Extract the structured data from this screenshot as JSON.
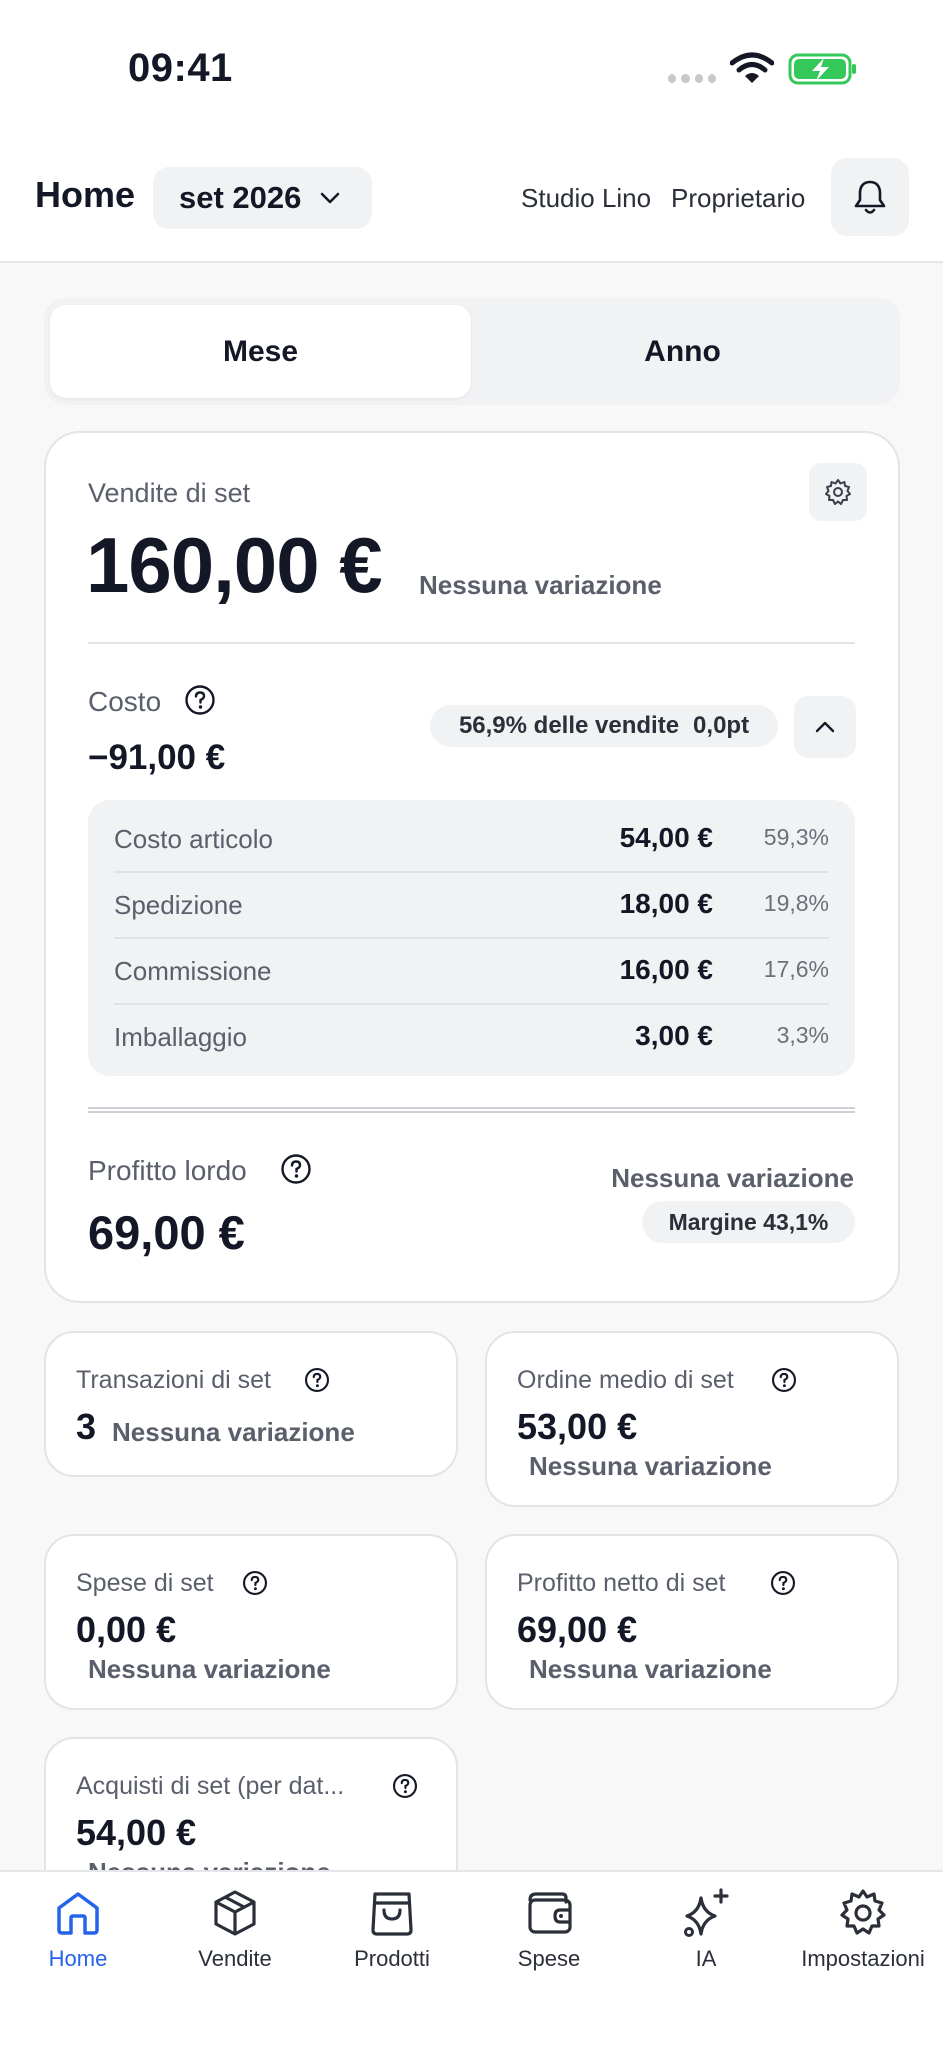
{
  "status_bar": {
    "time": "09:41"
  },
  "header": {
    "title": "Home",
    "month": "set 2026",
    "shop_name": "Studio Lino",
    "role": "Proprietario"
  },
  "segmented": {
    "month_label": "Mese",
    "year_label": "Anno",
    "active": "Mese"
  },
  "sales": {
    "label": "Vendite di set",
    "value": "160,00 €",
    "change": "Nessuna variazione"
  },
  "cost": {
    "label": "Costo",
    "value": "−91,00 €",
    "share": "56,9% delle vendite",
    "delta": "0,0pt",
    "breakdown": [
      {
        "name": "Costo articolo",
        "amount": "54,00 €",
        "percent": "59,3%"
      },
      {
        "name": "Spedizione",
        "amount": "18,00 €",
        "percent": "19,8%"
      },
      {
        "name": "Commissione",
        "amount": "16,00 €",
        "percent": "17,6%"
      },
      {
        "name": "Imballaggio",
        "amount": "3,00 €",
        "percent": "3,3%"
      }
    ]
  },
  "gross_profit": {
    "label": "Profitto lordo",
    "value": "69,00 €",
    "change": "Nessuna variazione",
    "margin": "Margine 43,1%"
  },
  "cards": [
    {
      "label": "Transazioni di set",
      "value": "3",
      "change": "Nessuna variazione"
    },
    {
      "label": "Ordine medio di set",
      "value": "53,00 €",
      "change": "Nessuna variazione"
    },
    {
      "label": "Spese di set",
      "value": "0,00 €",
      "change": "Nessuna variazione"
    },
    {
      "label": "Profitto netto di set",
      "value": "69,00 €",
      "change": "Nessuna variazione"
    },
    {
      "label": "Acquisti di set (per dat...",
      "value": "54,00 €",
      "change": "Nessuna variazione"
    }
  ],
  "nav": [
    {
      "label": "Home",
      "icon": "home-icon",
      "active": true
    },
    {
      "label": "Vendite",
      "icon": "box-icon"
    },
    {
      "label": "Prodotti",
      "icon": "bag-icon"
    },
    {
      "label": "Spese",
      "icon": "wallet-icon"
    },
    {
      "label": "IA",
      "icon": "sparkles-icon"
    },
    {
      "label": "Impostazioni",
      "icon": "gear-icon"
    }
  ],
  "colors": {
    "accent": "#2563eb",
    "text": "#141826",
    "muted": "#5a5f6b",
    "battery": "#34c759"
  }
}
